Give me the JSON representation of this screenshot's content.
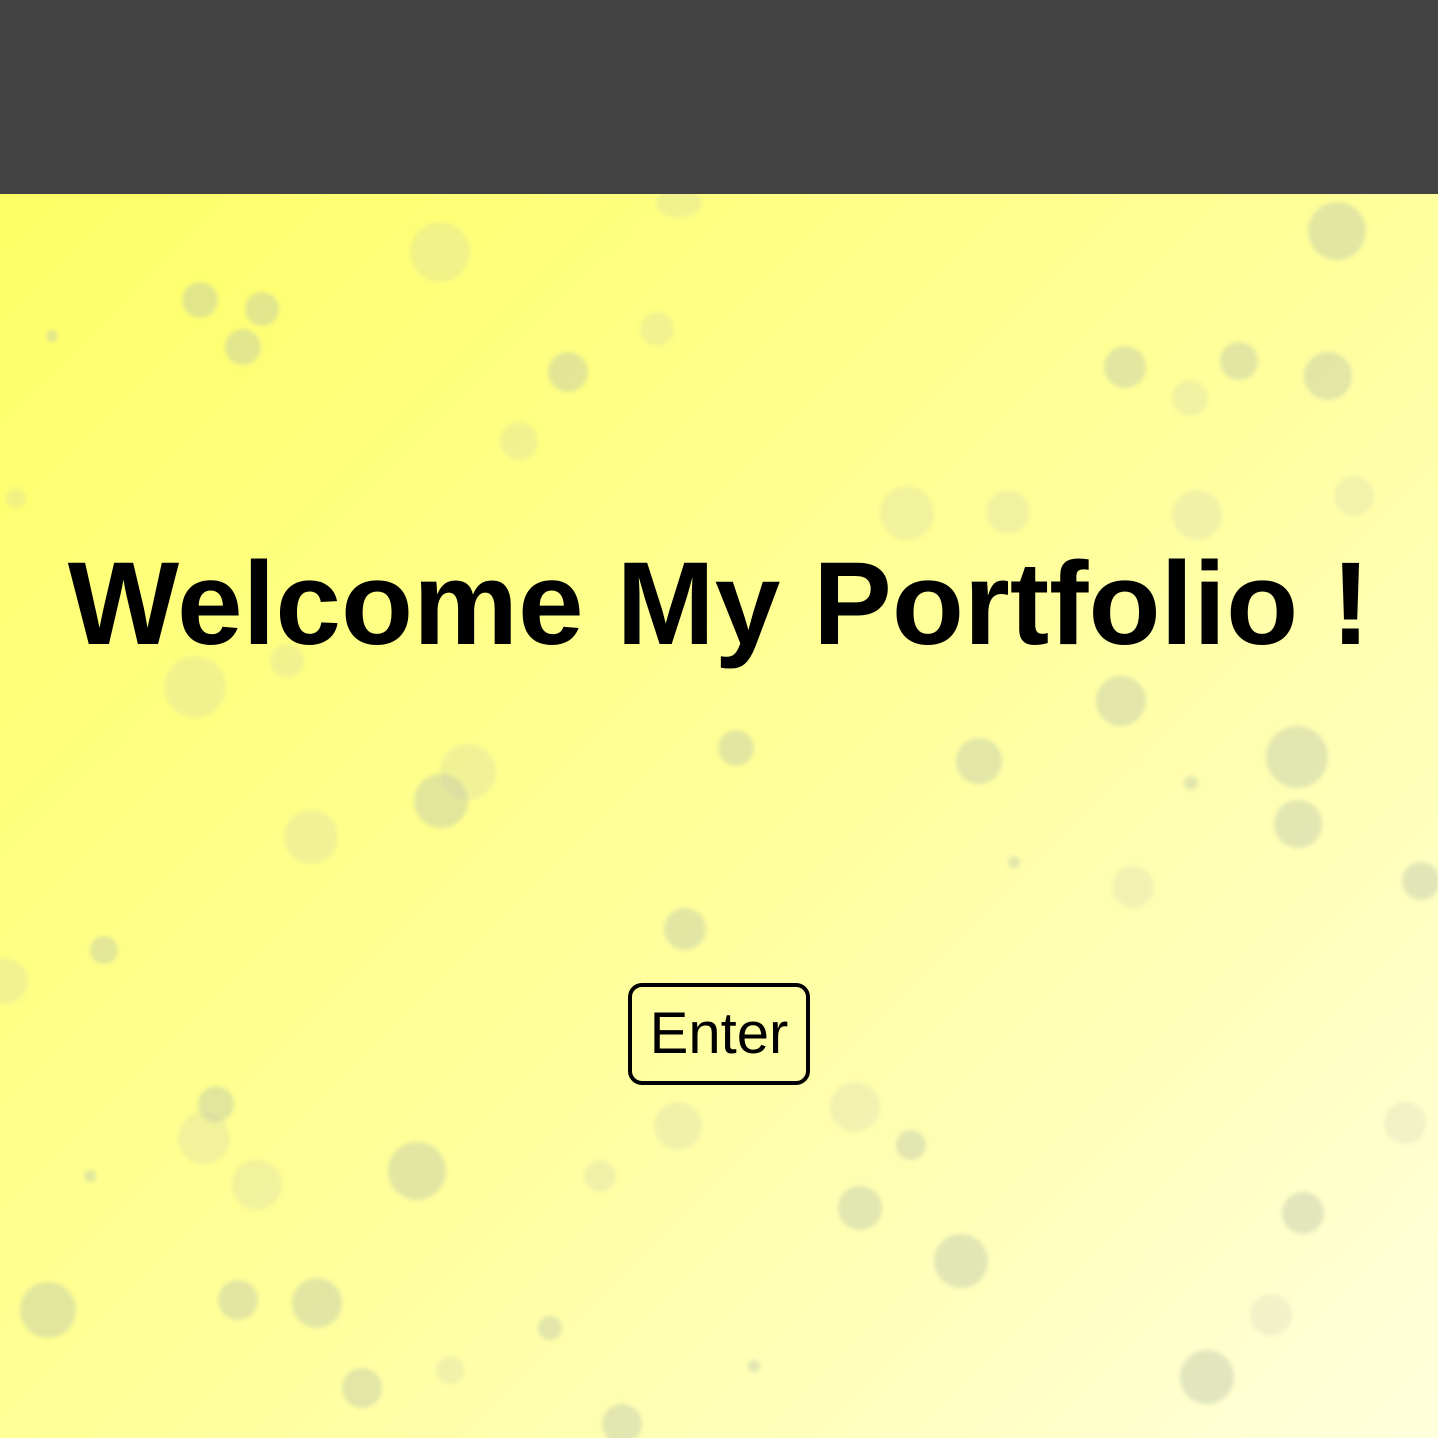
{
  "header": {
    "background_color": "#424242"
  },
  "hero": {
    "title": "Welcome My Portfolio !",
    "enter_label": "Enter",
    "gradient_colors": [
      "#ffff66",
      "#ffff99",
      "#ffffdd"
    ]
  }
}
